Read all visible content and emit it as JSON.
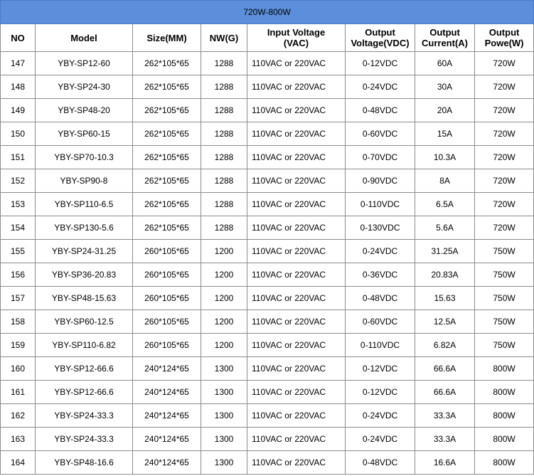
{
  "title": "720W-800W",
  "headers": {
    "no": "NO",
    "model": "Model",
    "size": "Size(MM)",
    "nw": "NW(G)",
    "input_l1": "Input Voltage",
    "input_l2": "(VAC)",
    "out_v_l1": "Output",
    "out_v_l2": "Voltage(VDC)",
    "out_c_l1": "Output",
    "out_c_l2": "Current(A)",
    "out_p_l1": "Output",
    "out_p_l2": "Powe(W)"
  },
  "rows": [
    {
      "no": "147",
      "model": "YBY-SP12-60",
      "size": "262*105*65",
      "nw": "1288",
      "input": "110VAC or 220VAC",
      "voltage": "0-12VDC",
      "current": "60A",
      "power": "720W"
    },
    {
      "no": "148",
      "model": "YBY-SP24-30",
      "size": "262*105*65",
      "nw": "1288",
      "input": "110VAC or 220VAC",
      "voltage": "0-24VDC",
      "current": "30A",
      "power": "720W"
    },
    {
      "no": "149",
      "model": "YBY-SP48-20",
      "size": "262*105*65",
      "nw": "1288",
      "input": "110VAC or 220VAC",
      "voltage": "0-48VDC",
      "current": "20A",
      "power": "720W"
    },
    {
      "no": "150",
      "model": "YBY-SP60-15",
      "size": "262*105*65",
      "nw": "1288",
      "input": "110VAC or 220VAC",
      "voltage": "0-60VDC",
      "current": "15A",
      "power": "720W"
    },
    {
      "no": "151",
      "model": "YBY-SP70-10.3",
      "size": "262*105*65",
      "nw": "1288",
      "input": "110VAC or 220VAC",
      "voltage": "0-70VDC",
      "current": "10.3A",
      "power": "720W"
    },
    {
      "no": "152",
      "model": "YBY-SP90-8",
      "size": "262*105*65",
      "nw": "1288",
      "input": "110VAC or 220VAC",
      "voltage": "0-90VDC",
      "current": "8A",
      "power": "720W"
    },
    {
      "no": "153",
      "model": "YBY-SP110-6.5",
      "size": "262*105*65",
      "nw": "1288",
      "input": "110VAC or 220VAC",
      "voltage": "0-110VDC",
      "current": "6.5A",
      "power": "720W"
    },
    {
      "no": "154",
      "model": "YBY-SP130-5.6",
      "size": "262*105*65",
      "nw": "1288",
      "input": "110VAC or 220VAC",
      "voltage": "0-130VDC",
      "current": "5.6A",
      "power": "720W"
    },
    {
      "no": "155",
      "model": "YBY-SP24-31.25",
      "size": "260*105*65",
      "nw": "1200",
      "input": "110VAC or 220VAC",
      "voltage": "0-24VDC",
      "current": "31.25A",
      "power": "750W"
    },
    {
      "no": "156",
      "model": "YBY-SP36-20.83",
      "size": "260*105*65",
      "nw": "1200",
      "input": "110VAC or 220VAC",
      "voltage": "0-36VDC",
      "current": "20.83A",
      "power": "750W"
    },
    {
      "no": "157",
      "model": "YBY-SP48-15.63",
      "size": "260*105*65",
      "nw": "1200",
      "input": "110VAC or 220VAC",
      "voltage": "0-48VDC",
      "current": "15.63",
      "power": "750W"
    },
    {
      "no": "158",
      "model": "YBY-SP60-12.5",
      "size": "260*105*65",
      "nw": "1200",
      "input": "110VAC or 220VAC",
      "voltage": "0-60VDC",
      "current": "12.5A",
      "power": "750W"
    },
    {
      "no": "159",
      "model": "YBY-SP110-6.82",
      "size": "260*105*65",
      "nw": "1200",
      "input": "110VAC or 220VAC",
      "voltage": "0-110VDC",
      "current": "6.82A",
      "power": "750W"
    },
    {
      "no": "160",
      "model": "YBY-SP12-66.6",
      "size": "240*124*65",
      "nw": "1300",
      "input": "110VAC or 220VAC",
      "voltage": "0-12VDC",
      "current": "66.6A",
      "power": "800W"
    },
    {
      "no": "161",
      "model": "YBY-SP12-66.6",
      "size": "240*124*65",
      "nw": "1300",
      "input": "110VAC or 220VAC",
      "voltage": "0-12VDC",
      "current": "66.6A",
      "power": "800W"
    },
    {
      "no": "162",
      "model": "YBY-SP24-33.3",
      "size": "240*124*65",
      "nw": "1300",
      "input": "110VAC or 220VAC",
      "voltage": "0-24VDC",
      "current": "33.3A",
      "power": "800W"
    },
    {
      "no": "163",
      "model": "YBY-SP24-33.3",
      "size": "240*124*65",
      "nw": "1300",
      "input": "110VAC or 220VAC",
      "voltage": "0-24VDC",
      "current": "33.3A",
      "power": "800W"
    },
    {
      "no": "164",
      "model": "YBY-SP48-16.6",
      "size": "240*124*65",
      "nw": "1300",
      "input": "110VAC or 220VAC",
      "voltage": "0-48VDC",
      "current": "16.6A",
      "power": "800W"
    }
  ]
}
